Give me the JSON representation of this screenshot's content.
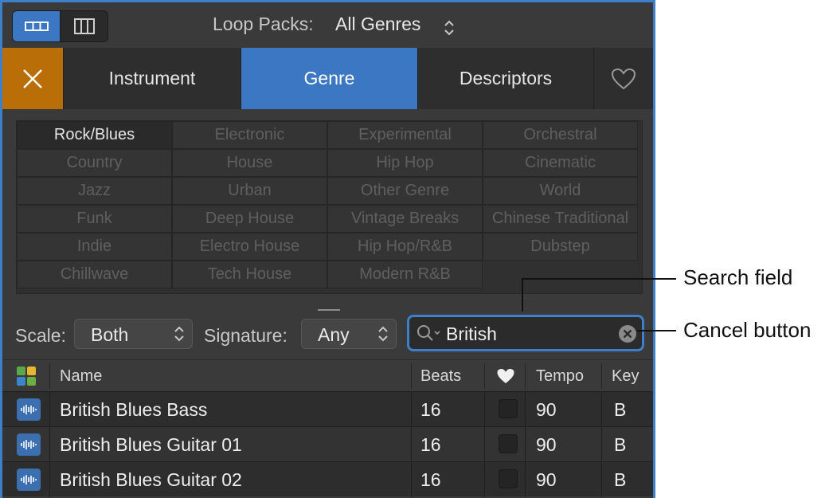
{
  "header": {
    "loop_packs_label": "Loop Packs:",
    "loop_packs_value": "All Genres"
  },
  "tabs": [
    {
      "label": "Instrument"
    },
    {
      "label": "Genre"
    },
    {
      "label": "Descriptors"
    }
  ],
  "genres": [
    [
      "Rock/Blues",
      "Electronic",
      "Experimental",
      "Orchestral"
    ],
    [
      "Country",
      "House",
      "Hip Hop",
      "Cinematic"
    ],
    [
      "Jazz",
      "Urban",
      "Other Genre",
      "World"
    ],
    [
      "Funk",
      "Deep House",
      "Vintage Breaks",
      "Chinese Traditional"
    ],
    [
      "Indie",
      "Electro House",
      "Hip Hop/R&B",
      "Dubstep"
    ],
    [
      "Chillwave",
      "Tech House",
      "Modern R&B",
      ""
    ]
  ],
  "filters": {
    "scale_label": "Scale:",
    "scale_value": "Both",
    "signature_label": "Signature:",
    "signature_value": "Any",
    "search_value": "British"
  },
  "table": {
    "columns": {
      "name": "Name",
      "beats": "Beats",
      "tempo": "Tempo",
      "key": "Key"
    },
    "rows": [
      {
        "name": "British Blues Bass",
        "beats": "16",
        "tempo": "90",
        "key": "B"
      },
      {
        "name": "British Blues Guitar 01",
        "beats": "16",
        "tempo": "90",
        "key": "B"
      },
      {
        "name": "British Blues Guitar 02",
        "beats": "16",
        "tempo": "90",
        "key": "B"
      }
    ]
  },
  "callouts": {
    "search_field": "Search field",
    "cancel_button": "Cancel button"
  },
  "colors": {
    "accent_blue": "#3b77c2",
    "close_orange": "#b96e07",
    "focus_ring": "#3d7fc9"
  }
}
